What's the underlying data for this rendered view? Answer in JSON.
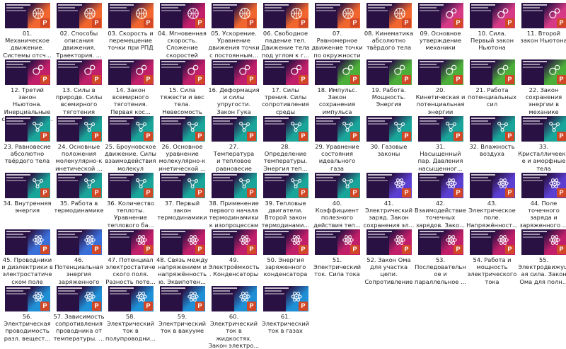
{
  "palette": {
    "orange": "#f0662e",
    "magenta": "#c21f6a",
    "green": "#4caf3a",
    "teal": "#1aa59a",
    "blue": "#3b6fd8",
    "violet": "#5b3fd0",
    "pink": "#d63a86",
    "cyan": "#1f8fd6",
    "ppt_red": "#d24726"
  },
  "ppt_glyph": "P",
  "files": [
    {
      "caption": "01.\nМеханическое\nдвижение.\nСистемы отсч...",
      "color": "orange",
      "icon": "basketball-icon"
    },
    {
      "caption": "02. Способы\nописания\nдвижения.\nТраектория. ...",
      "color": "orange",
      "icon": "basketball-icon"
    },
    {
      "caption": "03. Скорость и\nперемещение\nточки при РПД",
      "color": "orange",
      "icon": "basketball-icon"
    },
    {
      "caption": "04. Мгновенная\nскорость.\nСложение\nскоростей",
      "color": "magenta",
      "icon": "basketball-icon"
    },
    {
      "caption": "05. Ускорение.\nУравнение\nдвижения точки\nс постоянным...",
      "color": "orange",
      "icon": "basketball-icon"
    },
    {
      "caption": "06. Свободное\nпадение тел.\nДвижение тела\nпод углом к г...",
      "color": "orange",
      "icon": "basketball-icon"
    },
    {
      "caption": "07.\nРавномерное\nдвижение точки\nпо окружности",
      "color": "orange",
      "icon": "basketball-icon"
    },
    {
      "caption": "08. Кинематика\nабсолютно\nтвёрдого тела",
      "color": "orange",
      "icon": "basketball-icon"
    },
    {
      "caption": "09. Основное\nутверждение\nмеханики",
      "color": "pink",
      "icon": "flask-icon"
    },
    {
      "caption": "10. Сила.\nПервый закон\nНьютона",
      "color": "pink",
      "icon": "flask-icon"
    },
    {
      "caption": "11. Второй\nзакон Ньютона",
      "color": "pink",
      "icon": "flask-icon"
    },
    {
      "caption": "12. Третий закон\nНьютона.\nИнерциальные\nсистемы отсчё...",
      "color": "magenta",
      "icon": "flask-icon"
    },
    {
      "caption": "13. Силы в\nприроде. Силы\nвсемирного\nтяготения",
      "color": "magenta",
      "icon": "flask-icon"
    },
    {
      "caption": "14. Закон\nвсемирного\nтяготения.\nПервая кос...",
      "color": "magenta",
      "icon": "flask-icon"
    },
    {
      "caption": "15. Сила\nтяжести и вес\nтела.\nНевесомость",
      "color": "magenta",
      "icon": "flask-icon"
    },
    {
      "caption": "16. Деформация\nи силы\nупругости.\nЗакон Гука",
      "color": "magenta",
      "icon": "flask-icon"
    },
    {
      "caption": "17. Силы\nтрения. Силы\nсопротивления\nсреды",
      "color": "magenta",
      "icon": "flask-icon"
    },
    {
      "caption": "18. Импульс.\nЗакон\nсохранения\nимпульса",
      "color": "green",
      "icon": "flask-icon"
    },
    {
      "caption": "19. Работа.\nМощность.\nЭнергия",
      "color": "green",
      "icon": "flask-icon"
    },
    {
      "caption": "20.\nКинетическая и\nпотенциальная\nэнергии",
      "color": "green",
      "icon": "flask-icon"
    },
    {
      "caption": "21. Работа\nпотенциальных\nсил",
      "color": "green",
      "icon": "flask-icon"
    },
    {
      "caption": "22. Закон\nсохранения\nэнергии в\nмеханике",
      "color": "green",
      "icon": "flask-icon"
    },
    {
      "caption": "23. Равновесие\nабсолютно\nтвёрдого тела",
      "color": "teal",
      "icon": "molecule-icon"
    },
    {
      "caption": "24. Основные\nположения\nмолекулярно-к\nинетической ...",
      "color": "teal",
      "icon": "molecule-icon"
    },
    {
      "caption": "25. Броуновское\nдвижение. Силы\nвзаимодействия\nмолекул",
      "color": "teal",
      "icon": "molecule-icon"
    },
    {
      "caption": "26. Основное\nуравнение\nмолекулярно-к\nинетической ...",
      "color": "teal",
      "icon": "molecule-icon"
    },
    {
      "caption": "27. Температура\nи тепловое\nравновесие",
      "color": "teal",
      "icon": "molecule-icon"
    },
    {
      "caption": "28.\nОпределение\nтемпературы.\nЭнергия теп...",
      "color": "teal",
      "icon": "molecule-icon"
    },
    {
      "caption": "29. Уравнение\nсостояния\nидеального газа",
      "color": "teal",
      "icon": "molecule-icon"
    },
    {
      "caption": "30. Газовые\nзаконы",
      "color": "teal",
      "icon": "molecule-icon"
    },
    {
      "caption": "31.\nНасыщенный\nпар. Давления\nнасыщенног...",
      "color": "teal",
      "icon": "molecule-icon"
    },
    {
      "caption": "32. Влажность\nвоздуха",
      "color": "teal",
      "icon": "molecule-icon"
    },
    {
      "caption": "33.\nКристалличееки\nе и аморфные\nтела",
      "color": "teal",
      "icon": "molecule-icon"
    },
    {
      "caption": "34. Внутренняя\nэнергия",
      "color": "teal",
      "icon": "molecule-icon"
    },
    {
      "caption": "35. Работа в\nтермодинамике",
      "color": "teal",
      "icon": "molecule-icon"
    },
    {
      "caption": "36. Количество\nтеплоты.\nУравнение\nтеплового ба...",
      "color": "teal",
      "icon": "molecule-icon"
    },
    {
      "caption": "37. Первый\nзакон\nтермодинамики",
      "color": "teal",
      "icon": "molecule-icon"
    },
    {
      "caption": "38. Применение\nпервого начала\nтермодинамики\nк изопроцессам",
      "color": "teal",
      "icon": "molecule-icon"
    },
    {
      "caption": "39. Тепловые\nдвигатели.\nВторой закон\nтермодинами...",
      "color": "teal",
      "icon": "molecule-icon"
    },
    {
      "caption": "40.\nКоэффициент\nполезного\nдействия теп...",
      "color": "teal",
      "icon": "molecule-icon"
    },
    {
      "caption": "41.\nЭлектрический\nзаряд. Закон\nсохранения эл...",
      "color": "violet",
      "icon": "atom-icon"
    },
    {
      "caption": "42.\nВзаимодействие\nточечных\nзарядов. Зако...",
      "color": "violet",
      "icon": "atom-icon"
    },
    {
      "caption": "43.\nЭлектрическое\nполе.\nНапряжённост...",
      "color": "violet",
      "icon": "atom-icon"
    },
    {
      "caption": "44. Поле\nточечного\nзаряда и\nзаряженного ...",
      "color": "violet",
      "icon": "atom-icon"
    },
    {
      "caption": "45. Проводники\nи диэлектрики в\nэлектростатиче\nском поле",
      "color": "blue",
      "icon": "atom-icon"
    },
    {
      "caption": "46.\nПотенциальная\nэнергия\nзаряженного т...",
      "color": "blue",
      "icon": "atom-icon"
    },
    {
      "caption": "47. Потенциал\nэлектростатиче\nского поля.\nРазность поте...",
      "color": "magenta",
      "icon": "atom-icon"
    },
    {
      "caption": "48. Связь между\nнапряжением и\nнапряжённость\nю. Эквипотен...",
      "color": "magenta",
      "icon": "atom-icon"
    },
    {
      "caption": "49.\nЭлектроёмкость\n. Конденсаторы",
      "color": "magenta",
      "icon": "atom-icon"
    },
    {
      "caption": "50. Энергия\nзаряженного\nконденсатора",
      "color": "magenta",
      "icon": "atom-icon"
    },
    {
      "caption": "51.\nЭлектрический\nток. Сила тока",
      "color": "magenta",
      "icon": "atom-icon"
    },
    {
      "caption": "52. Закон Ома\nдля участка\nцепи.\nСопротивление",
      "color": "magenta",
      "icon": "atom-icon"
    },
    {
      "caption": "53.\nПоследовательн\nое и\nпараллельное ...",
      "color": "magenta",
      "icon": "atom-icon"
    },
    {
      "caption": "54. Работа и\nмощность\nэлектрического\nтока",
      "color": "magenta",
      "icon": "atom-icon"
    },
    {
      "caption": "55.\nЭлектродвижущ\nая сила. Закон\nОма для полн...",
      "color": "magenta",
      "icon": "atom-icon"
    },
    {
      "caption": "56.\nЭлектрическая\nпроводимость\nразл. вещест...",
      "color": "cyan",
      "icon": "atom-icon"
    },
    {
      "caption": "57. Зависимость\nсопротивления\nпроводника от\nтемпературы. ...",
      "color": "cyan",
      "icon": "atom-icon"
    },
    {
      "caption": "58.\nЭлектрический\nток в\nполупроводни...",
      "color": "cyan",
      "icon": "atom-icon"
    },
    {
      "caption": "59.\nЭлектрический\nток в вакууме",
      "color": "cyan",
      "icon": "atom-icon"
    },
    {
      "caption": "60.\nЭлектрический\nток в жидкостях.\nЗакон электро...",
      "color": "cyan",
      "icon": "atom-icon"
    },
    {
      "caption": "61.\nЭлектрический\nток в газах",
      "color": "cyan",
      "icon": "atom-icon"
    }
  ]
}
